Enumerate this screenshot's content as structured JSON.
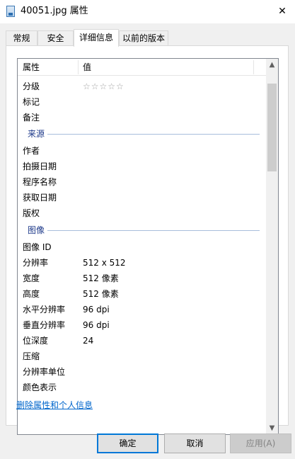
{
  "window": {
    "title": "40051.jpg 属性",
    "close_glyph": "✕"
  },
  "tabs": [
    {
      "label": "常规"
    },
    {
      "label": "安全"
    },
    {
      "label": "详细信息",
      "active": true
    },
    {
      "label": "以前的版本"
    }
  ],
  "list": {
    "header": {
      "col1": "属性",
      "col2": "值"
    },
    "rating_stars": "☆☆☆☆☆",
    "rows_top": [
      {
        "label": "分级",
        "value": ""
      },
      {
        "label": "标记",
        "value": ""
      },
      {
        "label": "备注",
        "value": ""
      }
    ],
    "group_source": "来源",
    "rows_source": [
      {
        "label": "作者",
        "value": ""
      },
      {
        "label": "拍摄日期",
        "value": ""
      },
      {
        "label": "程序名称",
        "value": ""
      },
      {
        "label": "获取日期",
        "value": ""
      },
      {
        "label": "版权",
        "value": ""
      }
    ],
    "group_image": "图像",
    "rows_image": [
      {
        "label": "图像 ID",
        "value": ""
      },
      {
        "label": "分辨率",
        "value": "512 x 512"
      },
      {
        "label": "宽度",
        "value": "512 像素"
      },
      {
        "label": "高度",
        "value": "512 像素"
      },
      {
        "label": "水平分辨率",
        "value": "96 dpi"
      },
      {
        "label": "垂直分辨率",
        "value": "96 dpi"
      },
      {
        "label": "位深度",
        "value": "24"
      },
      {
        "label": "压缩",
        "value": ""
      },
      {
        "label": "分辨率单位",
        "value": ""
      },
      {
        "label": "颜色表示",
        "value": ""
      }
    ]
  },
  "scrollbar": {
    "up_glyph": "▲",
    "down_glyph": "▼"
  },
  "remove_link": "删除属性和个人信息",
  "buttons": {
    "ok": "确定",
    "cancel": "取消",
    "apply": "应用(A)"
  },
  "colors": {
    "link": "#0066cc",
    "group_title": "#1e3a8a",
    "primary_border": "#0078d7"
  }
}
